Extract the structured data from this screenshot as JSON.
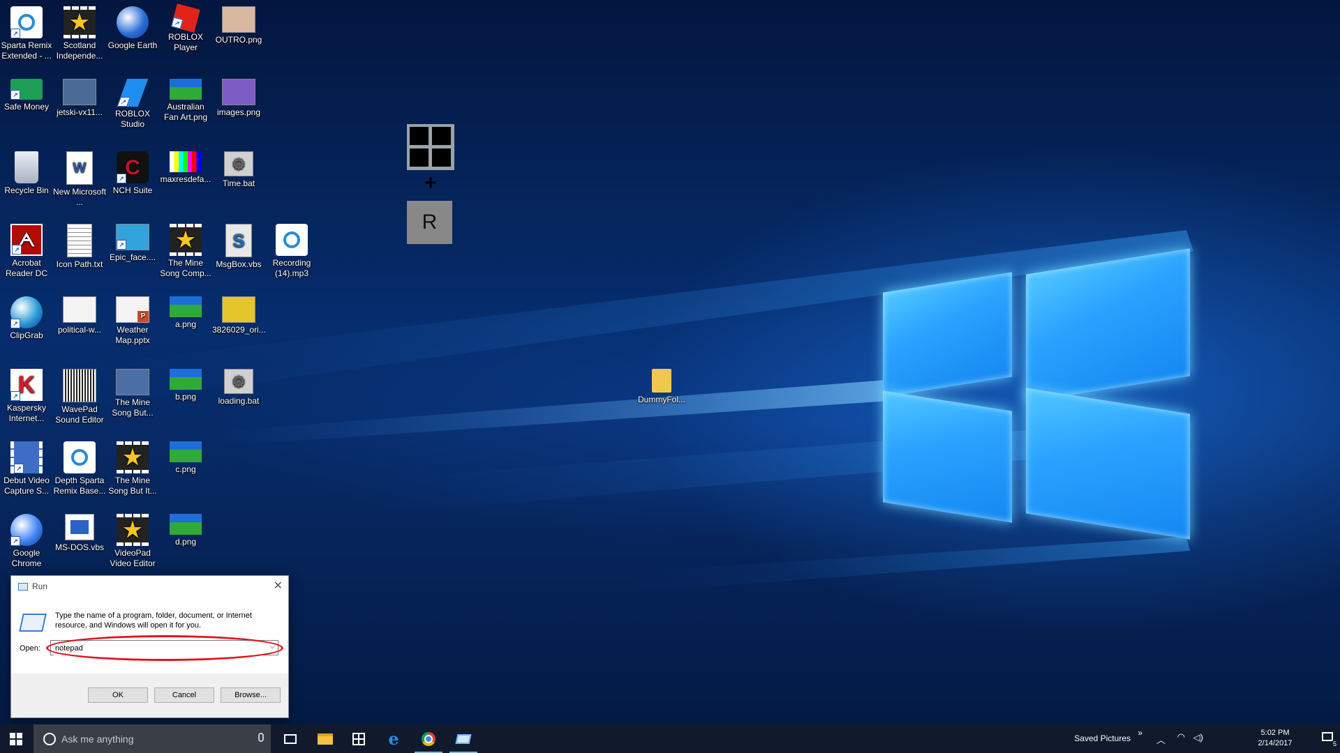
{
  "desktop": {
    "icons": [
      {
        "label": "Sparta Remix Extended - ...",
        "icon": "media-disc-icon",
        "color": "#ffffff"
      },
      {
        "label": "Scotland Independe...",
        "icon": "star-video-icon",
        "color": "#222222"
      },
      {
        "label": "Google Earth",
        "icon": "globe-icon",
        "color": "#2d6fd6"
      },
      {
        "label": "ROBLOX Player",
        "icon": "roblox-icon",
        "color": "#e2231a"
      },
      {
        "label": "OUTRO.png",
        "icon": "image-file-icon",
        "color": "#d9b8a0"
      },
      {
        "label": "Safe Money",
        "icon": "card-icon",
        "color": "#1e9e54"
      },
      {
        "label": "jetski-vx11...",
        "icon": "image-file-icon",
        "color": "#4a6b95"
      },
      {
        "label": "ROBLOX Studio",
        "icon": "roblox-studio-icon",
        "color": "#1f8ef0"
      },
      {
        "label": "Australian Fan Art.png",
        "icon": "flag-image-icon",
        "color": "#3bb34a"
      },
      {
        "label": "images.png",
        "icon": "image-file-icon",
        "color": "#7d5cc6"
      },
      {
        "label": "Recycle Bin",
        "icon": "recycle-bin-icon",
        "color": "#c6ced8"
      },
      {
        "label": "New Microsoft ...",
        "icon": "word-doc-icon",
        "color": "#2b579a"
      },
      {
        "label": "NCH Suite",
        "icon": "nch-icon",
        "color": "#c8102e"
      },
      {
        "label": "maxresdefa...",
        "icon": "color-bars-icon",
        "color": "#444444"
      },
      {
        "label": "Time.bat",
        "icon": "gear-file-icon",
        "color": "#d0d0d0"
      },
      {
        "label": "Acrobat Reader DC",
        "icon": "pdf-icon",
        "color": "#b30b00"
      },
      {
        "label": "Icon Path.txt",
        "icon": "text-file-icon",
        "color": "#f2f2f2"
      },
      {
        "label": "Epic_face....",
        "icon": "image-file-icon",
        "color": "#31a3dd"
      },
      {
        "label": "The Mine Song Comp...",
        "icon": "star-video-icon",
        "color": "#222222"
      },
      {
        "label": "MsgBox.vbs",
        "icon": "script-file-icon",
        "color": "#e8e8e8"
      },
      {
        "label": "Recording (14).mp3",
        "icon": "media-disc-icon",
        "color": "#ffffff"
      },
      {
        "label": "ClipGrab",
        "icon": "clipgrab-icon",
        "color": "#2b9bd8"
      },
      {
        "label": "political-w...",
        "icon": "image-file-icon",
        "color": "#f4f4f4"
      },
      {
        "label": "Weather Map.pptx",
        "icon": "ppt-file-icon",
        "color": "#d24726"
      },
      {
        "label": "a.png",
        "icon": "flag-image-icon",
        "color": "#3bb34a"
      },
      {
        "label": "3826029_ori...",
        "icon": "image-file-icon",
        "color": "#e5c62a"
      },
      {
        "label": "Kaspersky Internet...",
        "icon": "kaspersky-icon",
        "color": "#d21e2b"
      },
      {
        "label": "WavePad Sound Editor",
        "icon": "waveform-icon",
        "color": "#333333"
      },
      {
        "label": "The Mine Song But...",
        "icon": "image-file-icon",
        "color": "#4b6fa5"
      },
      {
        "label": "b.png",
        "icon": "flag-image-icon",
        "color": "#3bb34a"
      },
      {
        "label": "loading.bat",
        "icon": "gear-file-icon",
        "color": "#d0d0d0"
      },
      {
        "label": "Debut Video Capture S...",
        "icon": "film-icon",
        "color": "#3d6ec5"
      },
      {
        "label": "Depth Sparta Remix Base...",
        "icon": "media-disc-icon",
        "color": "#ffffff"
      },
      {
        "label": "The Mine Song But It...",
        "icon": "star-video-icon",
        "color": "#222222"
      },
      {
        "label": "c.png",
        "icon": "flag-image-icon",
        "color": "#3bb34a"
      },
      {
        "label": "Google Chrome",
        "icon": "chrome-icon",
        "color": "#4285f4"
      },
      {
        "label": "MS-DOS.vbs",
        "icon": "script-window-icon",
        "color": "#2b62c4"
      },
      {
        "label": "VideoPad Video Editor",
        "icon": "star-video-icon",
        "color": "#222222"
      },
      {
        "label": "d.png",
        "icon": "flag-image-icon",
        "color": "#3bb34a"
      },
      {
        "label": "DummyFol...",
        "icon": "folder-icon",
        "color": "#f0c850"
      }
    ]
  },
  "hint": {
    "plus": "+",
    "key": "R"
  },
  "run_dialog": {
    "title": "Run",
    "description": "Type the name of a program, folder, document, or Internet resource, and Windows will open it for you.",
    "open_label": "Open:",
    "open_value": "notepad",
    "ok_label": "OK",
    "cancel_label": "Cancel",
    "browse_label": "Browse...",
    "highlight_color": "#e0141e"
  },
  "taskbar": {
    "search_placeholder": "Ask me anything",
    "apps": [
      "task-view-icon",
      "file-explorer-icon",
      "store-icon",
      "edge-icon",
      "chrome-icon",
      "run-icon"
    ],
    "tray": {
      "saved_pictures": "Saved Pictures",
      "time": "5:02 PM",
      "date": "2/14/2017",
      "notification_count": "5"
    }
  }
}
